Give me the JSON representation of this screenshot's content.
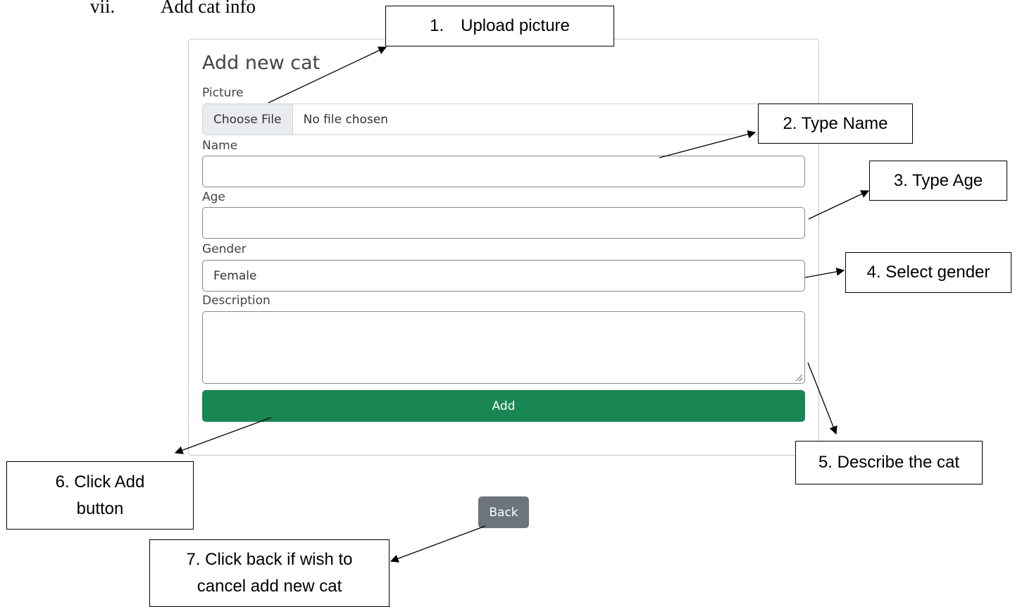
{
  "doc": {
    "heading_number": "vii.",
    "heading_text": "Add cat info"
  },
  "form": {
    "title": "Add new cat",
    "picture_label": "Picture",
    "choose_file": "Choose File",
    "file_status": "No file chosen",
    "name_label": "Name",
    "name_value": "",
    "age_label": "Age",
    "age_value": "",
    "gender_label": "Gender",
    "gender_value": "Female",
    "description_label": "Description",
    "description_value": "",
    "add_button": "Add",
    "back_button": "Back"
  },
  "callouts": {
    "upload": "1. Upload picture",
    "name": "2. Type Name",
    "age": "3. Type Age",
    "gender": "4. Select gender",
    "describe": "5. Describe the cat",
    "add_line1": "6. Click Add",
    "add_line2": "button",
    "back_line1": "7. Click back if wish to",
    "back_line2": "cancel add new cat"
  },
  "colors": {
    "add_button": "#198754",
    "back_button": "#6c757d"
  }
}
